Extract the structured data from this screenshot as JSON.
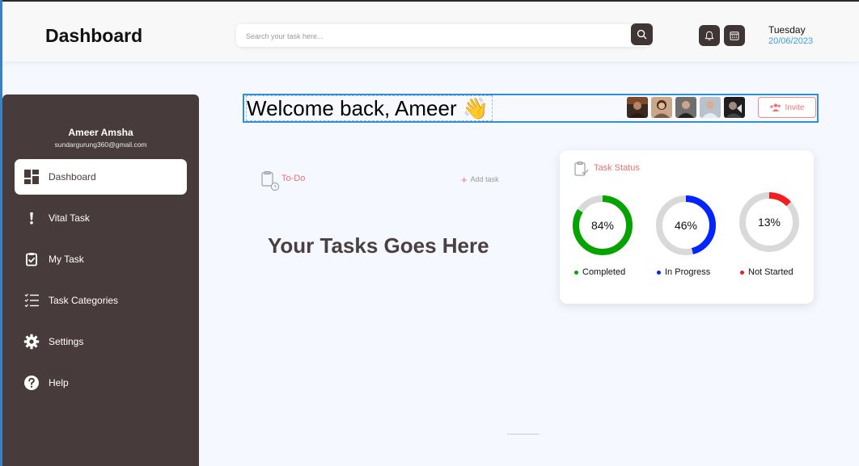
{
  "header": {
    "title": "Dashboard",
    "search_placeholder": "Search your task here...",
    "day": "Tuesday",
    "date": "20/06/2023"
  },
  "user": {
    "name": "Ameer Amsha",
    "email": "sundargurung360@gmail.com"
  },
  "sidebar": {
    "items": [
      {
        "label": "Dashboard",
        "icon": "dashboard-icon",
        "active": true
      },
      {
        "label": "Vital Task",
        "icon": "exclamation-icon"
      },
      {
        "label": "My Task",
        "icon": "clipboard-check-icon"
      },
      {
        "label": "Task Categories",
        "icon": "list-icon"
      },
      {
        "label": "Settings",
        "icon": "gear-icon"
      },
      {
        "label": "Help",
        "icon": "question-icon"
      }
    ]
  },
  "welcome": {
    "text": "Welcome back,  Ameer 👋",
    "invite_label": "Invite"
  },
  "todo": {
    "label": "To-Do",
    "add_task": "Add task",
    "empty_message": "Your Tasks Goes Here"
  },
  "task_status": {
    "title": "Task Status",
    "items": [
      {
        "label": "Completed",
        "percent": 84,
        "text": "84%",
        "color": "#05a301"
      },
      {
        "label": "In Progress",
        "percent": 46,
        "text": "46%",
        "color": "#0225ff"
      },
      {
        "label": "Not Started",
        "percent": 13,
        "text": "13%",
        "color": "#f21e1e"
      }
    ]
  },
  "colors": {
    "sidebar_bg": "#473c3b",
    "accent": "#f07070",
    "date": "#3aa0e0"
  }
}
